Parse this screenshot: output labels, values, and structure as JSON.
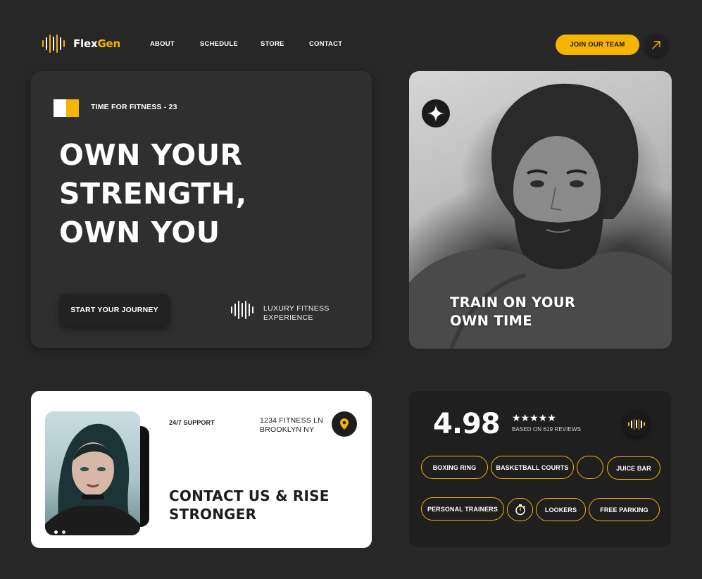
{
  "brand": {
    "name_part1": "Flex",
    "name_part2": "Gen",
    "accent": "#f5b400"
  },
  "nav": {
    "items": [
      {
        "label": "ABOUT"
      },
      {
        "label": "SCHEDULE"
      },
      {
        "label": "STORE"
      },
      {
        "label": "CONTACT"
      }
    ],
    "cta_label": "JOIN OUR TEAM",
    "cta_icon": "arrow-up-right-icon"
  },
  "hero": {
    "eyebrow": "TIME FOR FITNESS - 23",
    "title_lines": [
      "OWN YOUR",
      "STRENGTH,",
      "OWN YOU"
    ],
    "button_label": "START YOUR JOURNEY",
    "tagline_lines": [
      "LUXURY FITNESS",
      "EXPERIENCE"
    ]
  },
  "photo_card": {
    "caption_lines": [
      "TRAIN ON YOUR",
      "OWN TIME"
    ],
    "badge_icon": "sparkle-star-icon"
  },
  "contact": {
    "support_label": "24/7 SUPPORT",
    "address_lines": [
      "1234 FITNESS LN",
      "BROOKLYN NY"
    ],
    "title_lines": [
      "CONTACT US & RISE",
      "STRONGER"
    ],
    "location_icon": "map-pin-icon"
  },
  "rating": {
    "value": "4.98",
    "stars": "★★★★★",
    "star_count": 5,
    "reviews_label": "BASED ON 619 REVIEWS",
    "amenities_row1": [
      "BOXING RING",
      "BASKETBALL COURTS",
      "",
      "JUICE BAR"
    ],
    "amenities_row2": [
      "PERSONAL TRAINERS",
      "",
      "LOOKERS",
      "FREE PARKING"
    ],
    "stopwatch_icon": "stopwatch-icon"
  }
}
